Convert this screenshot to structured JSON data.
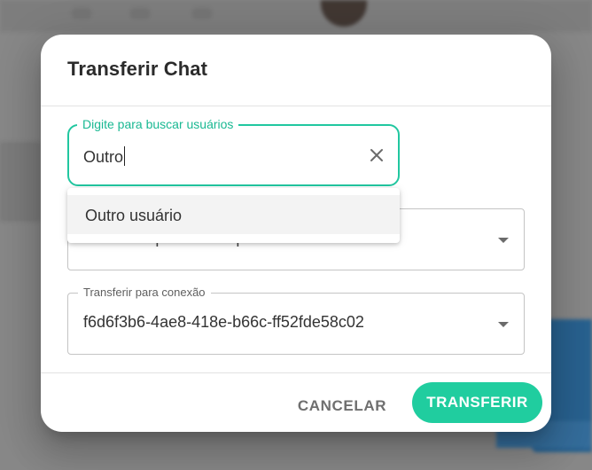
{
  "dialog": {
    "title": "Transferir Chat",
    "search": {
      "label": "Digite para buscar usuários",
      "value": "Outro",
      "clear_icon": "close-icon"
    },
    "autocomplete": {
      "options": [
        "Outro usuário"
      ]
    },
    "department": {
      "value": "Transferir para um departamento",
      "dropdown_icon": "caret-down-icon"
    },
    "connection": {
      "label": "Transferir para conexão",
      "value": "f6d6f3b6-4ae8-418e-b66c-ff52fde58c02",
      "dropdown_icon": "caret-down-icon"
    },
    "actions": {
      "cancel_label": "CANCELAR",
      "transfer_label": "TRANSFERIR"
    }
  },
  "colors": {
    "accent": "#20cd9f",
    "focus_border": "#21c7a0"
  }
}
